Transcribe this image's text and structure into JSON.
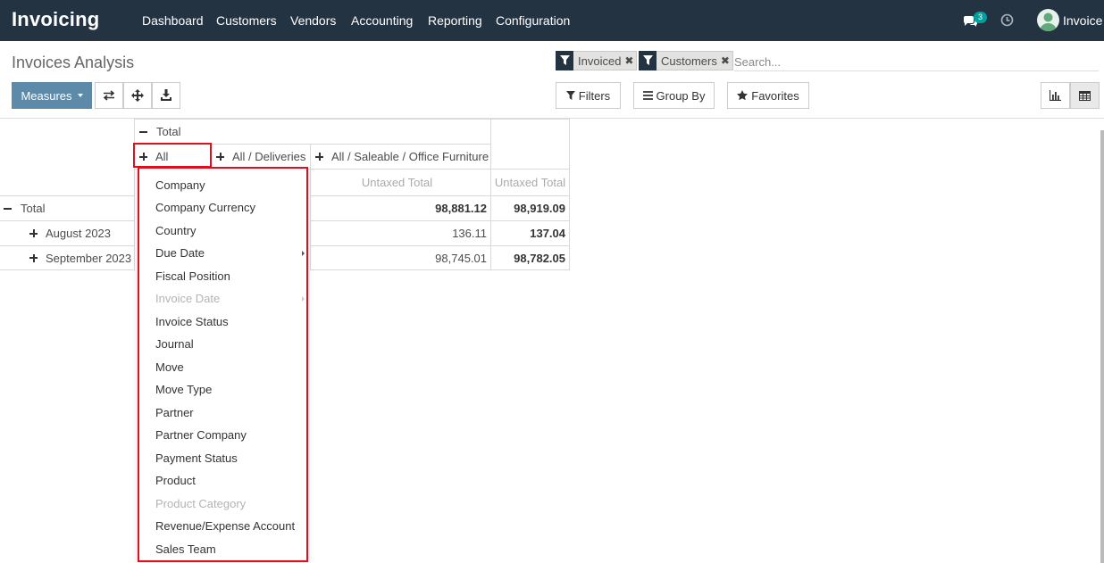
{
  "app": {
    "title": "Invoicing",
    "menu": [
      "Dashboard",
      "Customers",
      "Vendors",
      "Accounting",
      "Reporting",
      "Configuration"
    ],
    "chat_badge": "3",
    "user_name": "Invoice"
  },
  "control_panel": {
    "page_title": "Invoices Analysis",
    "facets": [
      {
        "label": "Invoiced",
        "icon": "filter-icon"
      },
      {
        "label": "Customers",
        "icon": "filter-icon"
      }
    ],
    "search_placeholder": "Search...",
    "measures_label": "Measures",
    "filters_label": "Filters",
    "group_by_label": "Group By",
    "favorites_label": "Favorites",
    "toolbar_icons": [
      "flip-axis-icon",
      "expand-all-icon",
      "download-icon"
    ],
    "views": [
      "graph-view-icon",
      "pivot-view-icon"
    ],
    "active_view": "pivot"
  },
  "pivot": {
    "col_total_header": "Total",
    "col_groups": [
      "All",
      "All / Deliveries",
      "All / Saleable / Office Furniture"
    ],
    "measure_headers": [
      "Untaxed Total",
      "Untaxed Total"
    ],
    "rows": [
      {
        "label": "Total",
        "value": "98,881.12",
        "total": "98,919.09"
      },
      {
        "label": "August 2023",
        "value": "136.11",
        "total": "137.04"
      },
      {
        "label": "September 2023",
        "value": "98,745.01",
        "total": "98,782.05"
      }
    ]
  },
  "groupby_dropdown": {
    "items": [
      {
        "label": "Company",
        "disabled": false,
        "submenu": false
      },
      {
        "label": "Company Currency",
        "disabled": false,
        "submenu": false
      },
      {
        "label": "Country",
        "disabled": false,
        "submenu": false
      },
      {
        "label": "Due Date",
        "disabled": false,
        "submenu": true
      },
      {
        "label": "Fiscal Position",
        "disabled": false,
        "submenu": false
      },
      {
        "label": "Invoice Date",
        "disabled": true,
        "submenu": true
      },
      {
        "label": "Invoice Status",
        "disabled": false,
        "submenu": false
      },
      {
        "label": "Journal",
        "disabled": false,
        "submenu": false
      },
      {
        "label": "Move",
        "disabled": false,
        "submenu": false
      },
      {
        "label": "Move Type",
        "disabled": false,
        "submenu": false
      },
      {
        "label": "Partner",
        "disabled": false,
        "submenu": false
      },
      {
        "label": "Partner Company",
        "disabled": false,
        "submenu": false
      },
      {
        "label": "Payment Status",
        "disabled": false,
        "submenu": false
      },
      {
        "label": "Product",
        "disabled": false,
        "submenu": false
      },
      {
        "label": "Product Category",
        "disabled": true,
        "submenu": false
      },
      {
        "label": "Revenue/Expense Account",
        "disabled": false,
        "submenu": false
      },
      {
        "label": "Sales Team",
        "disabled": false,
        "submenu": false
      }
    ]
  },
  "colors": {
    "navbar": "#243342",
    "primary_button": "#5c8aa8",
    "highlight": "#e10e1c",
    "badge": "#00a09d"
  }
}
